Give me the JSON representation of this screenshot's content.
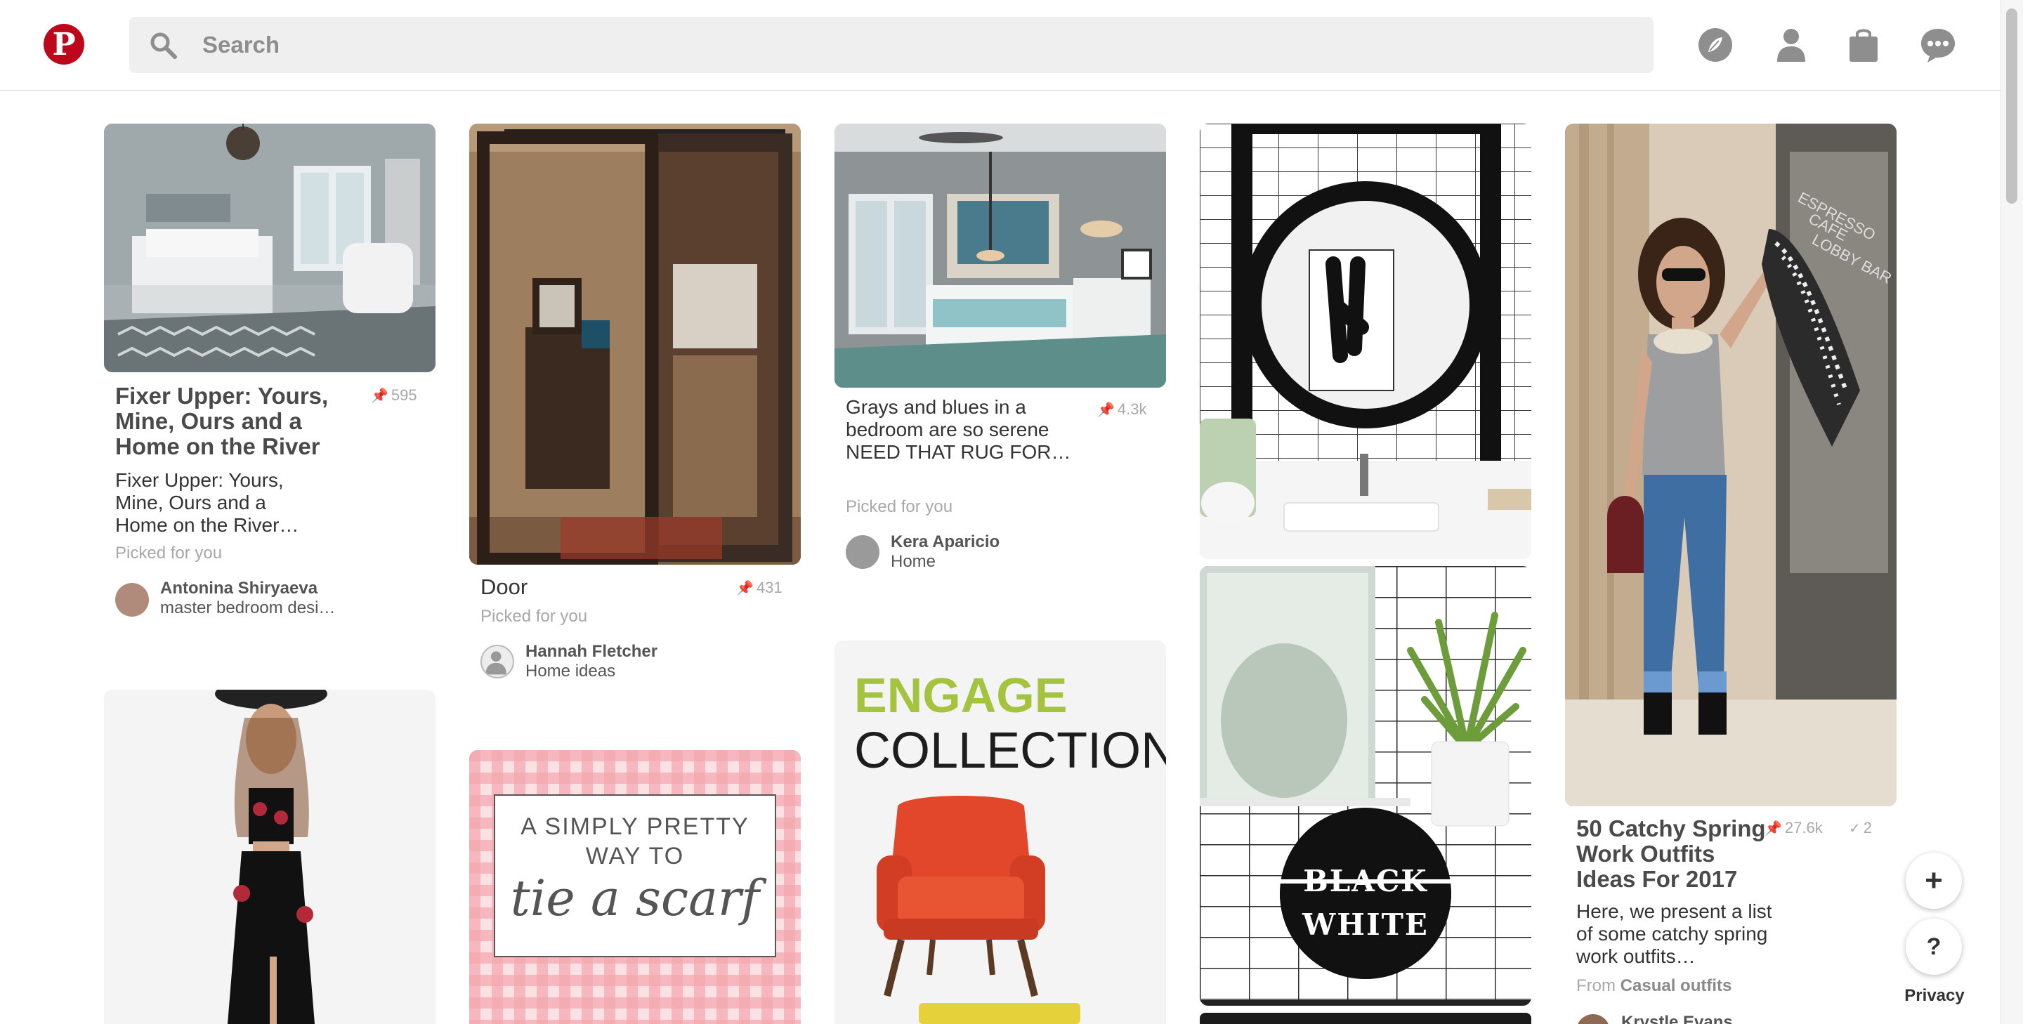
{
  "header": {
    "logo_letter": "P",
    "search_placeholder": "Search",
    "icons": [
      "explore-icon",
      "profile-icon",
      "shop-icon",
      "messages-icon"
    ]
  },
  "colors": {
    "brand": "#bd081c",
    "background": "#ffffff",
    "search_bg": "#efefef"
  },
  "pins": [
    {
      "id": "fixer",
      "title": "Fixer Upper: Yours, Mine, Ours and a Home on the River",
      "saves": "595",
      "description": "Fixer Upper: Yours, Mine, Ours and a Home on the River…",
      "attribution": "Picked for you",
      "user": "Antonina Shiryaeva",
      "board": "master bedroom desi…"
    },
    {
      "id": "door",
      "title": "Door",
      "saves": "431",
      "attribution": "Picked for you",
      "user": "Hannah Fletcher",
      "board": "Home ideas"
    },
    {
      "id": "grays",
      "title": "Grays and blues in a bedroom are so serene NEED THAT RUG FOR…",
      "saves": "4.3k",
      "attribution": "Picked for you",
      "user": "Kera Aparicio",
      "board": "Home"
    },
    {
      "id": "outfits",
      "title": "50 Catchy Spring Work Outfits Ideas For 2017",
      "saves": "27.6k",
      "tried": "2",
      "description": "Here, we present a list of some catchy spring work outfits…",
      "attribution_prefix": "From",
      "attribution_source": "Casual outfits",
      "user": "Krystle Evans"
    },
    {
      "id": "dress"
    },
    {
      "id": "scarf",
      "graphic_text": {
        "line1": "A SIMPLY PRETTY",
        "line2": "WAY TO",
        "script": "tie a scarf"
      }
    },
    {
      "id": "engage",
      "graphic_text": {
        "line1": "ENGAGE",
        "line2": "COLLECTION"
      }
    },
    {
      "id": "mirror"
    },
    {
      "id": "bw",
      "graphic_text": {
        "line1": "BLACK",
        "line2": "WHITE"
      }
    }
  ],
  "fab": {
    "add": "+",
    "help": "?",
    "privacy": "Privacy"
  }
}
